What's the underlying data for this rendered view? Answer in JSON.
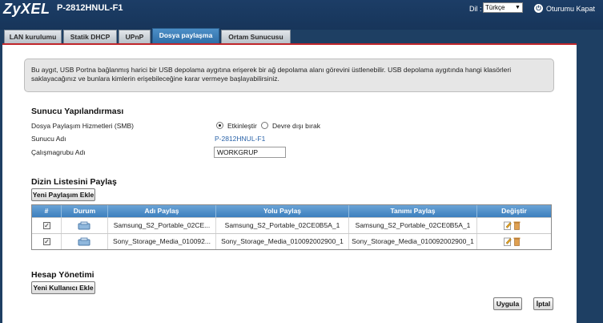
{
  "header": {
    "logo": "ZyXEL",
    "model": "P-2812HNUL-F1",
    "language_label": "Dil :",
    "language_value": "Türkçe",
    "logout_label": "Oturumu Kapat"
  },
  "tabs": [
    {
      "label": "LAN kurulumu"
    },
    {
      "label": "Statik DHCP"
    },
    {
      "label": "UPnP"
    },
    {
      "label": "Dosya paylaşma"
    },
    {
      "label": "Ortam Sunucusu"
    }
  ],
  "notice": "Bu aygıt, USB Portna bağlanmış harici bir USB depolama aygıtına erişerek bir ağ depolama alanı görevini üstlenebilir. USB depolama aygıtında hangi klasörleri saklayacağınız ve bunlara kimlerin erişebileceğine karar vermeye başlayabilirsiniz.",
  "server_config": {
    "title": "Sunucu Yapılandırması",
    "smb_label": "Dosya Paylaşım Hizmetleri (SMB)",
    "enable_label": "Etkinleştir",
    "disable_label": "Devre dışı bırak",
    "server_name_label": "Sunucu Adı",
    "server_name_value": "P-2812HNUL-F1",
    "workgroup_label": "Çalışmagrubu Adı",
    "workgroup_value": "WORKGRUP"
  },
  "share_list": {
    "title": "Dizin Listesini Paylaş",
    "add_button": "Yeni Paylaşım Ekle",
    "columns": [
      "#",
      "Durum",
      "Adı Paylaş",
      "Yolu Paylaş",
      "Tanımı Paylaş",
      "Değiştir"
    ],
    "rows": [
      {
        "name": "Samsung_S2_Portable_02CE...",
        "path": "Samsung_S2_Portable_02CE0B5A_1",
        "description": "Samsung_S2_Portable_02CE0B5A_1"
      },
      {
        "name": "Sony_Storage_Media_010092...",
        "path": "Sony_Storage_Media_010092002900_1",
        "description": "Sony_Storage_Media_010092002900_1"
      }
    ]
  },
  "account": {
    "title": "Hesap Yönetimi",
    "add_user_button": "Yeni Kullanıcı Ekle"
  },
  "actions": {
    "apply": "Uygula",
    "cancel": "İptal"
  }
}
